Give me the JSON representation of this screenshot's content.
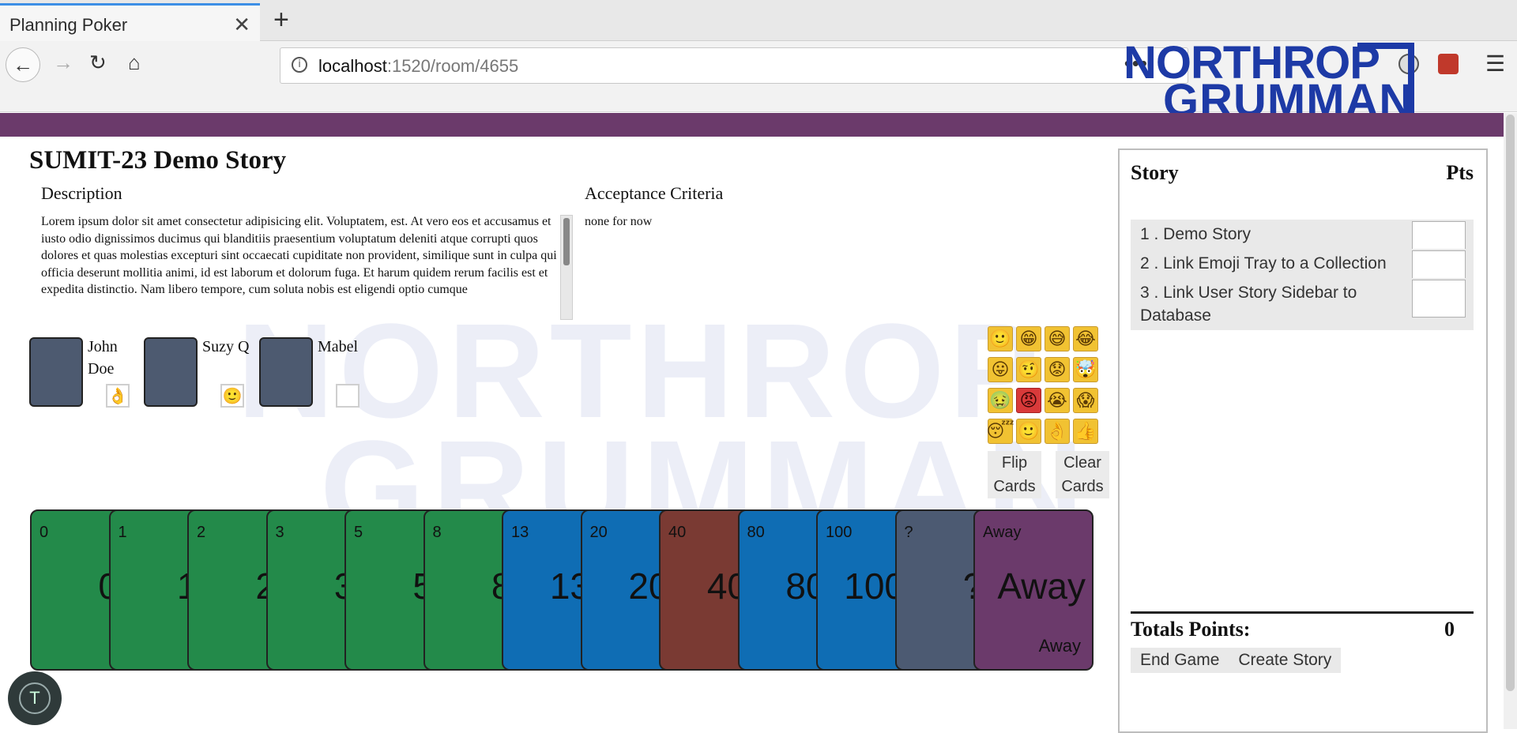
{
  "browser": {
    "tab_title": "Planning Poker",
    "tab_close": "✕",
    "new_tab": "+",
    "url_host": "localhost",
    "url_path": ":1520/room/4655",
    "url_more": "•••",
    "back": "←",
    "forward": "→",
    "reload": "↻",
    "home": "⌂",
    "menu": "☰"
  },
  "logo": {
    "line1": "NORTHROP",
    "line2": "GRUMMAN"
  },
  "watermark": {
    "line1": "NORTHROP",
    "line2": "GRUMMAN"
  },
  "story": {
    "title": "SUMIT-23 Demo Story",
    "description_heading": "Description",
    "description": "Lorem ipsum dolor sit amet consectetur adipisicing elit. Voluptatem, est. At vero eos et accusamus et iusto odio dignissimos ducimus qui blanditiis praesentium voluptatum deleniti atque corrupti quos dolores et quas molestias excepturi sint occaecati cupiditate non provident, similique sunt in culpa qui officia deserunt mollitia animi, id est laborum et dolorum fuga. Et harum quidem rerum facilis est et expedita distinctio. Nam libero tempore, cum soluta nobis est eligendi optio cumque",
    "acceptance_heading": "Acceptance Criteria",
    "acceptance": "none for now"
  },
  "players": [
    {
      "name": "John Doe",
      "emoji": "👌",
      "emoji_icon": "ok-hand-icon"
    },
    {
      "name": "Suzy Q",
      "emoji": "🙂",
      "emoji_icon": "smile-icon"
    },
    {
      "name": "Mabel",
      "emoji": "",
      "emoji_icon": "empty"
    }
  ],
  "emoji_tray": {
    "emojis": [
      "🙂",
      "😁",
      "😅",
      "😂",
      "😛",
      "🤨",
      "😟",
      "🤯",
      "🤢",
      "😡",
      "😭",
      "😱",
      "😴",
      "🙂",
      "👌",
      "👍"
    ],
    "icon_names": [
      "slight-smile",
      "grin",
      "sweat-smile",
      "joy",
      "tongue",
      "raised-eyebrow",
      "worried",
      "exploding-head",
      "nauseated",
      "angry",
      "sob",
      "scream",
      "sleeping",
      "neutral-smile",
      "ok-hand",
      "thumbs-up"
    ],
    "flip_label": "Flip Cards",
    "clear_label": "Clear Cards"
  },
  "cards": [
    {
      "corner": "0",
      "value": "0",
      "color": "#238a4a"
    },
    {
      "corner": "1",
      "value": "1",
      "color": "#238a4a"
    },
    {
      "corner": "2",
      "value": "2",
      "color": "#238a4a"
    },
    {
      "corner": "3",
      "value": "3",
      "color": "#238a4a"
    },
    {
      "corner": "5",
      "value": "5",
      "color": "#238a4a"
    },
    {
      "corner": "8",
      "value": "8",
      "color": "#238a4a"
    },
    {
      "corner": "13",
      "value": "13",
      "color": "#0f6db4"
    },
    {
      "corner": "20",
      "value": "20",
      "color": "#0f6db4"
    },
    {
      "corner": "40",
      "value": "40",
      "color": "#7a3a33"
    },
    {
      "corner": "80",
      "value": "80",
      "color": "#0f6db4"
    },
    {
      "corner": "100",
      "value": "100",
      "color": "#0f6db4"
    },
    {
      "corner": "?",
      "value": "?",
      "color": "#4c5a72"
    },
    {
      "corner": "Away",
      "value": "Away",
      "bottom": "Away",
      "color": "#6b3a6b"
    }
  ],
  "sidebar": {
    "story_heading": "Story",
    "pts_heading": "Pts",
    "stories": [
      {
        "label": "1 . Demo Story"
      },
      {
        "label": "2 . Link Emoji Tray to a Collection"
      },
      {
        "label": "3 . Link User Story Sidebar to Database"
      }
    ],
    "total_label": "Totals Points:",
    "total_value": "0",
    "end_game": "End Game",
    "create_story": "Create Story"
  },
  "fab_icon": "T",
  "colors": {
    "header_purple": "#6b3a6b",
    "logo_blue": "#1d3aa6",
    "card_green": "#238a4a",
    "card_blue": "#0f6db4",
    "card_brown": "#7a3a33",
    "card_slate": "#4c5a72"
  }
}
